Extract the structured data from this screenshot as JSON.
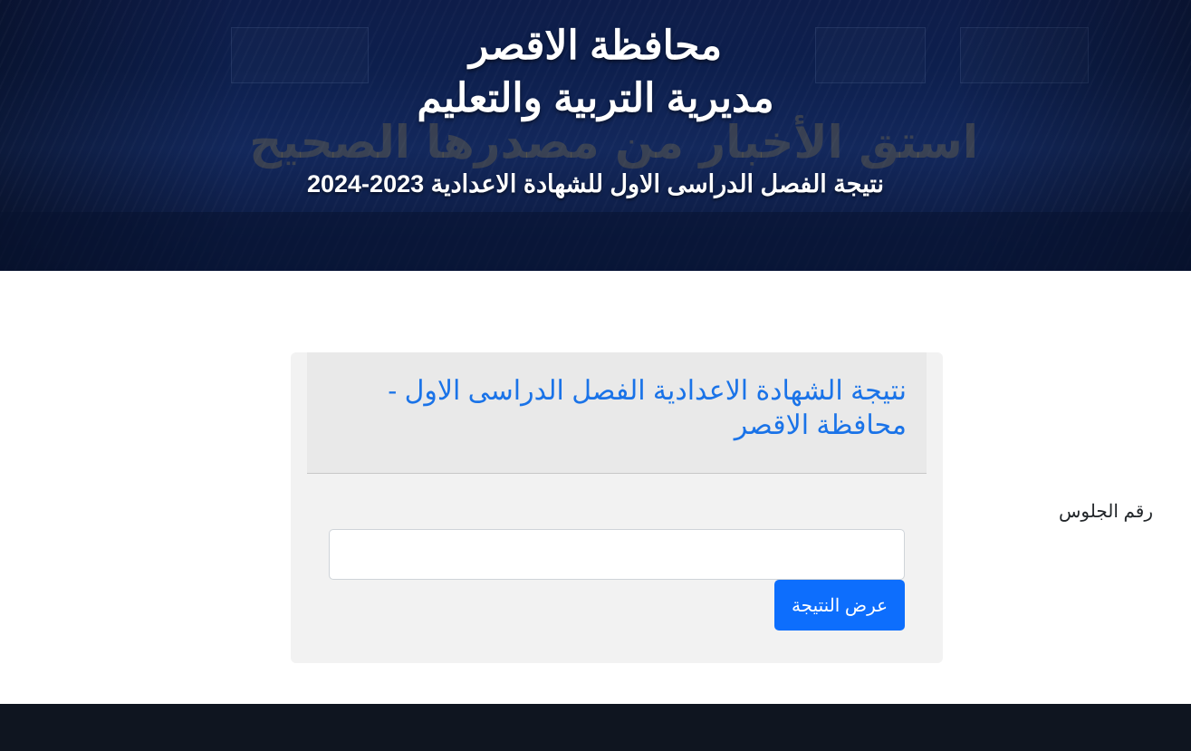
{
  "header": {
    "title_line1": "محافظة الاقصر",
    "title_line2": "مديرية التربية والتعليم",
    "subtitle": "نتيجة الفصل الدراسى الاول للشهادة الاعدادية 2023-2024",
    "background_slogan": "استق الأخبار من مصدرها الصحيح"
  },
  "card": {
    "title": "نتيجة الشهادة الاعدادية الفصل الدراسى الاول - محافظة الاقصر",
    "seat_label": "رقم الجلوس",
    "seat_value": "",
    "submit_label": "عرض النتيجة"
  },
  "colors": {
    "header_bg": "#0e1d4a",
    "link_blue": "#1a73e8",
    "button_blue": "#0d6efd",
    "footer_bg": "#0f1520"
  }
}
